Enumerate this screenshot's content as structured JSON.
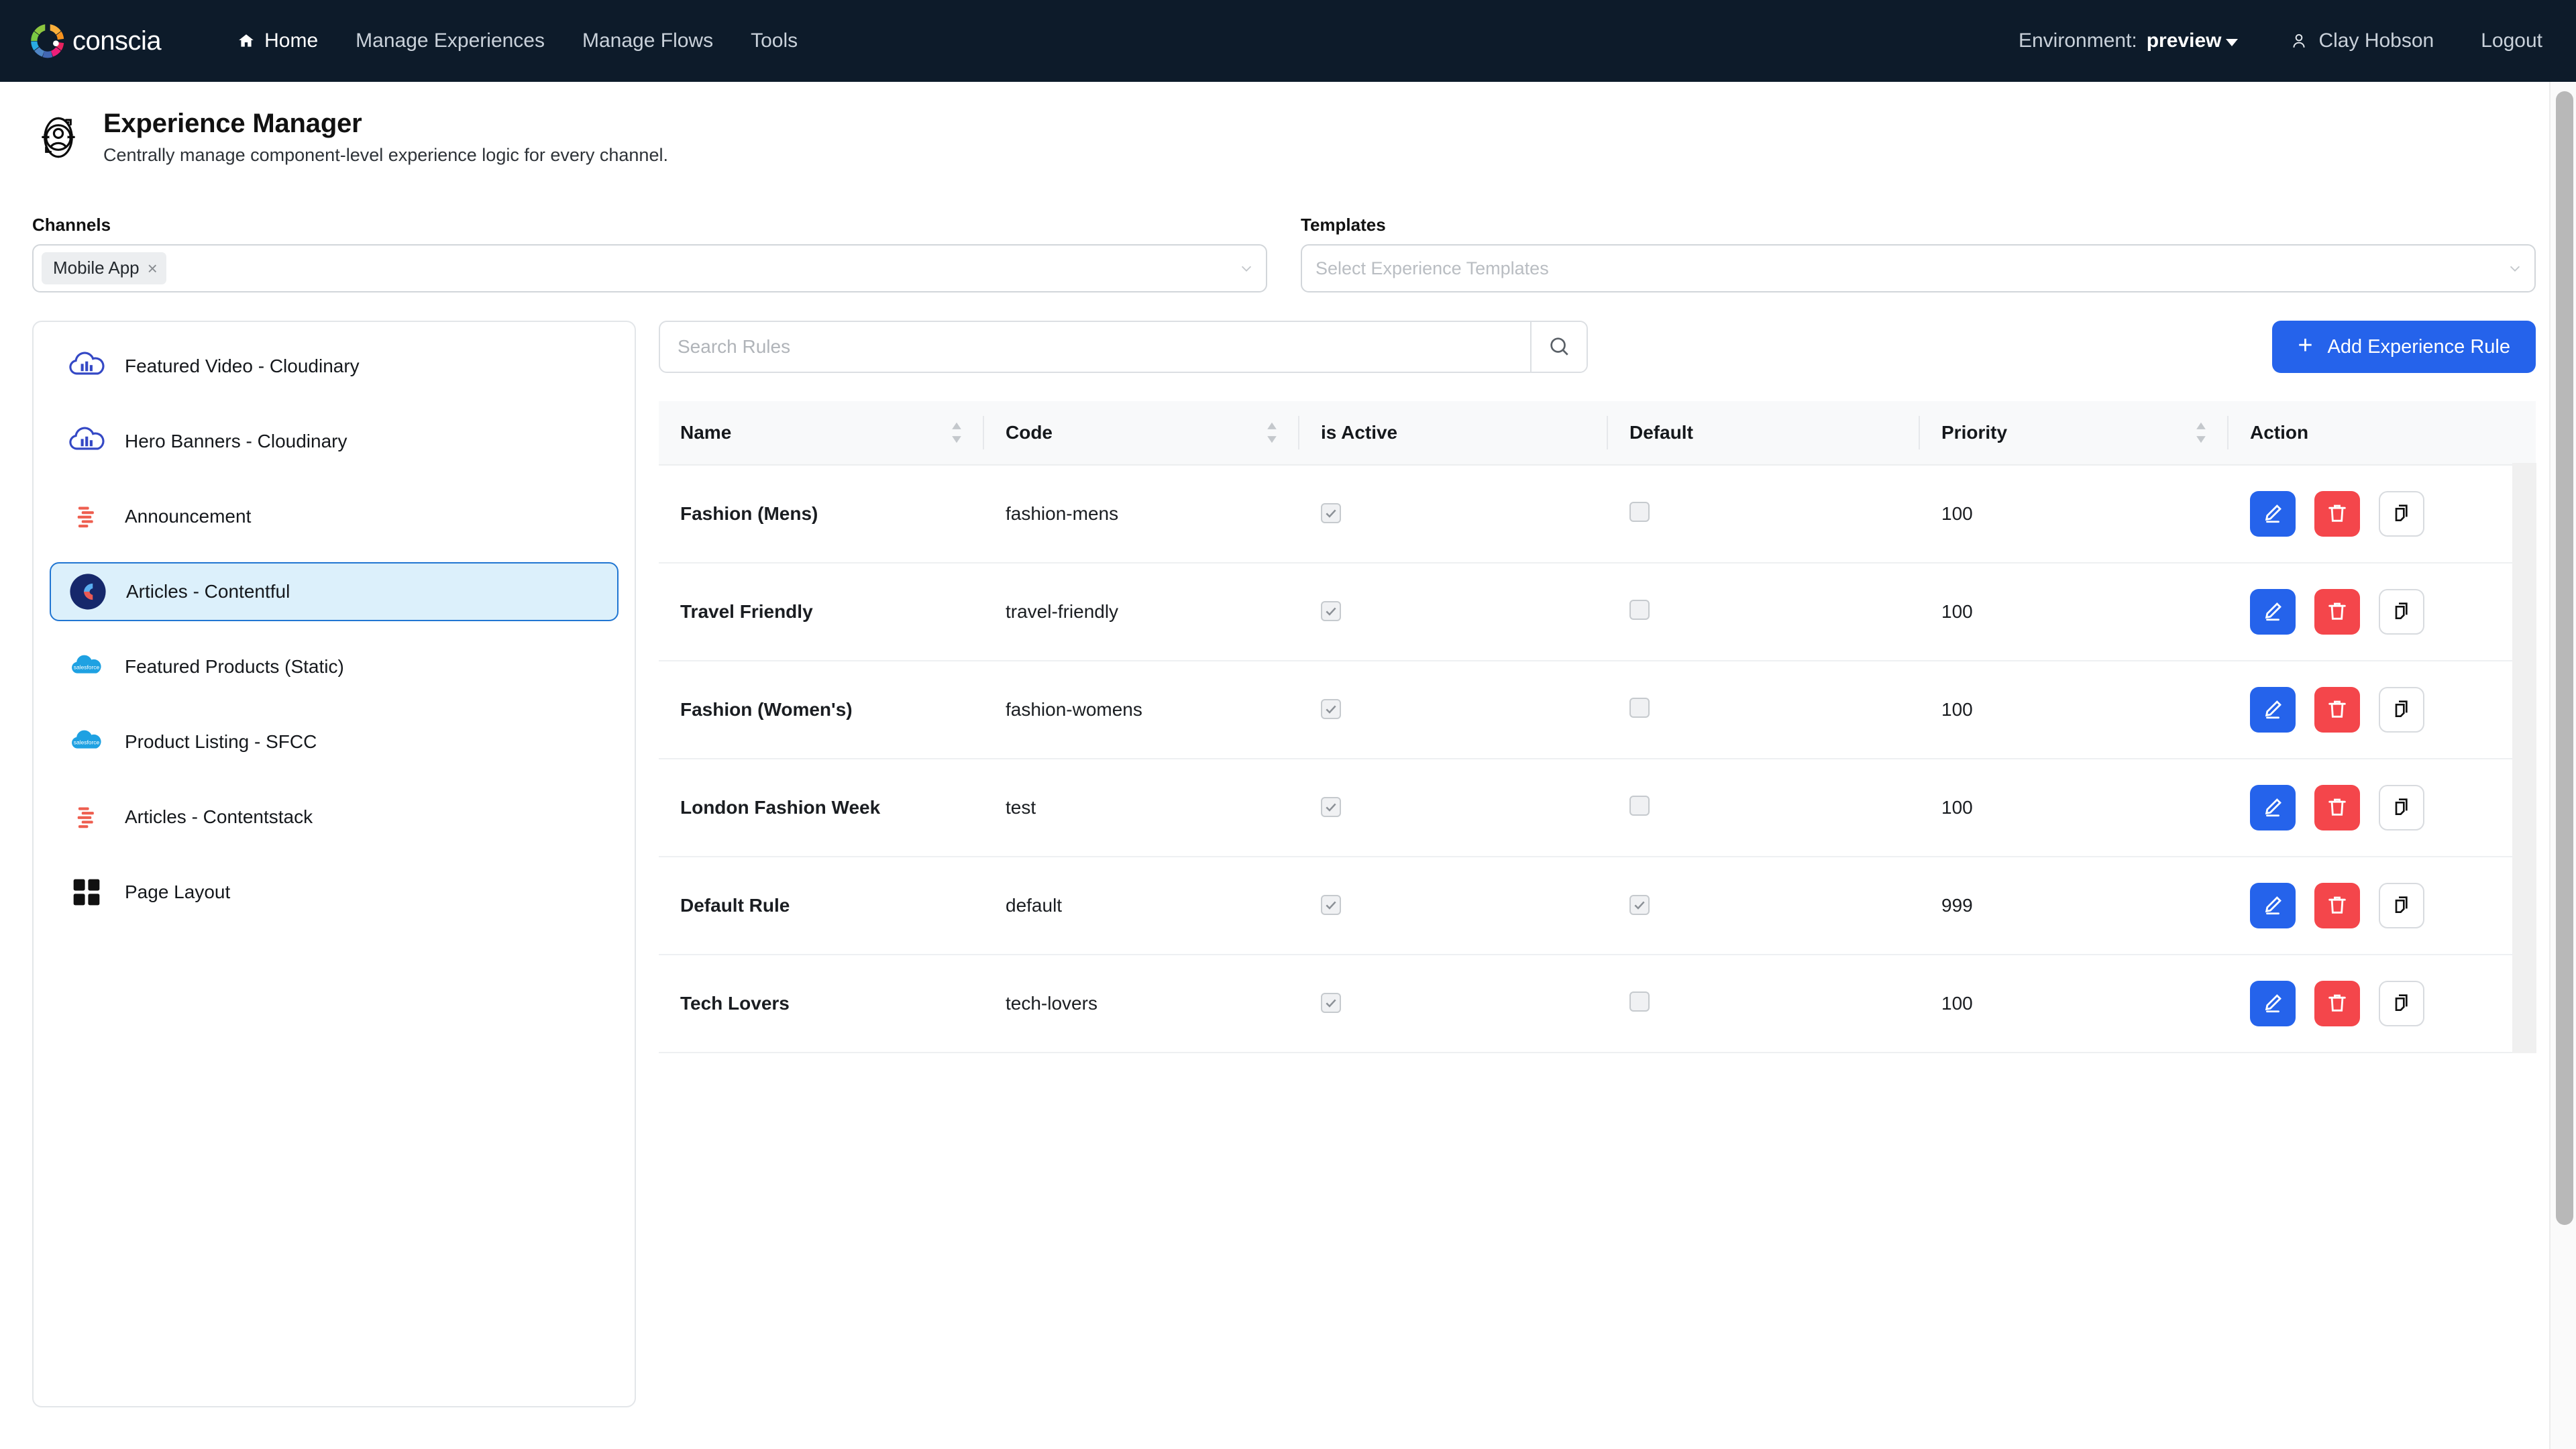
{
  "navbar": {
    "brand": {
      "name": "conscia",
      "logo_icon": "conscia-ring-logo"
    },
    "links": [
      {
        "label": "Home",
        "icon": "home-icon",
        "active": true
      },
      {
        "label": "Manage Experiences",
        "icon": "",
        "active": false
      },
      {
        "label": "Manage Flows",
        "icon": "",
        "active": false
      },
      {
        "label": "Tools",
        "icon": "",
        "active": false
      }
    ],
    "environment_label": "Environment:",
    "environment_value": "preview",
    "user_name": "Clay Hobson",
    "logout_label": "Logout"
  },
  "header": {
    "icon": "experience-manager-icon",
    "title": "Experience Manager",
    "subtitle": "Centrally manage component-level experience logic for every channel."
  },
  "filters": {
    "channels": {
      "label": "Channels",
      "selected_chip": "Mobile App",
      "chip_remove": "×"
    },
    "templates": {
      "label": "Templates",
      "placeholder": "Select Experience Templates"
    }
  },
  "sidebar": {
    "items": [
      {
        "label": "Featured Video - Cloudinary",
        "icon": "cloudinary-icon",
        "selected": false
      },
      {
        "label": "Hero Banners - Cloudinary",
        "icon": "cloudinary-icon",
        "selected": false
      },
      {
        "label": "Announcement",
        "icon": "contentstack-icon",
        "selected": false
      },
      {
        "label": "Articles - Contentful",
        "icon": "contentful-icon",
        "selected": true
      },
      {
        "label": "Featured Products (Static)",
        "icon": "salesforce-icon",
        "selected": false
      },
      {
        "label": "Product Listing - SFCC",
        "icon": "salesforce-icon",
        "selected": false
      },
      {
        "label": "Articles - Contentstack",
        "icon": "contentstack-icon",
        "selected": false
      },
      {
        "label": "Page Layout",
        "icon": "page-layout-icon",
        "selected": false
      }
    ]
  },
  "toolbar": {
    "search_placeholder": "Search Rules",
    "search_value": "",
    "search_icon": "search-icon",
    "add_button_label": "Add Experience Rule",
    "add_button_icon": "plus-icon"
  },
  "table": {
    "columns": [
      {
        "label": "Name",
        "sortable": true
      },
      {
        "label": "Code",
        "sortable": true
      },
      {
        "label": "is Active",
        "sortable": false
      },
      {
        "label": "Default",
        "sortable": false
      },
      {
        "label": "Priority",
        "sortable": true
      },
      {
        "label": "Action",
        "sortable": false
      }
    ],
    "rows": [
      {
        "name": "Fashion (Mens)",
        "code": "fashion-mens",
        "is_active": true,
        "default": false,
        "priority": "100"
      },
      {
        "name": "Travel Friendly",
        "code": "travel-friendly",
        "is_active": true,
        "default": false,
        "priority": "100"
      },
      {
        "name": "Fashion (Women's)",
        "code": "fashion-womens",
        "is_active": true,
        "default": false,
        "priority": "100"
      },
      {
        "name": "London Fashion Week",
        "code": "test",
        "is_active": true,
        "default": false,
        "priority": "100"
      },
      {
        "name": "Default Rule",
        "code": "default",
        "is_active": true,
        "default": true,
        "priority": "999"
      },
      {
        "name": "Tech Lovers",
        "code": "tech-lovers",
        "is_active": true,
        "default": false,
        "priority": "100"
      }
    ],
    "action_icons": {
      "edit": "pencil-icon",
      "delete": "trash-icon",
      "duplicate": "copy-icon"
    }
  },
  "colors": {
    "navbar_bg": "#0d1b2a",
    "accent_blue": "#2563eb",
    "danger_red": "#f4464b",
    "selected_item_bg": "#dcf0fb",
    "selected_item_border": "#2176d2"
  }
}
